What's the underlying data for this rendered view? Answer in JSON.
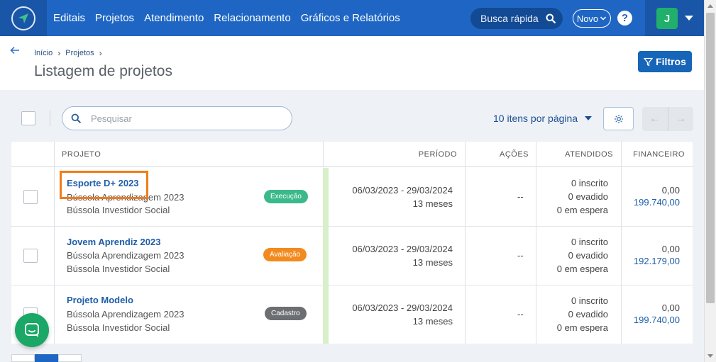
{
  "nav": {
    "items": [
      "Editais",
      "Projetos",
      "Atendimento",
      "Relacionamento",
      "Gráficos e Relatórios"
    ],
    "quick_search": "Busca rápida",
    "novo": "Novo",
    "help": "?",
    "user_initial": "J"
  },
  "breadcrumb": [
    "Início",
    "Projetos"
  ],
  "page_title": "Listagem de projetos",
  "filtros_label": "Filtros",
  "toolbar": {
    "search_placeholder": "Pesquisar",
    "per_page": "10 itens por página"
  },
  "table": {
    "headers": [
      "PROJETO",
      "PERÍODO",
      "AÇÕES",
      "ATENDIDOS",
      "FINANCEIRO"
    ],
    "rows": [
      {
        "name": "Esporte D+ 2023",
        "program": "Bússola Aprendizagem 2023",
        "org": "Bússola Investidor Social",
        "status": "Execução",
        "status_color": "#3bb98a",
        "period": "06/03/2023 - 29/03/2024",
        "duration": "13 meses",
        "acoes": "--",
        "inscrito": "0 inscrito",
        "evadido": "0 evadido",
        "espera": "0 em espera",
        "fin_a": "0,00",
        "fin_b": "199.740,00"
      },
      {
        "name": "Jovem Aprendiz 2023",
        "program": "Bússola Aprendizagem 2023",
        "org": "Bússola Investidor Social",
        "status": "Avaliação",
        "status_color": "#f28a1e",
        "period": "06/03/2023 - 29/03/2024",
        "duration": "13 meses",
        "acoes": "--",
        "inscrito": "0 inscrito",
        "evadido": "0 evadido",
        "espera": "0 em espera",
        "fin_a": "0,00",
        "fin_b": "192.179,00"
      },
      {
        "name": "Projeto Modelo",
        "program": "Bússola Aprendizagem 2023",
        "org": "Bússola Investidor Social",
        "status": "Cadastro",
        "status_color": "#6b6e72",
        "period": "06/03/2023 - 29/03/2024",
        "duration": "13 meses",
        "acoes": "--",
        "inscrito": "0 inscrito",
        "evadido": "0 evadido",
        "espera": "0 em espera",
        "fin_a": "0,00",
        "fin_b": "199.740,00"
      }
    ]
  },
  "colors": {
    "nav_bg": "#1f66c4",
    "accent": "#1665b8",
    "highlight": "#f07c1b",
    "chat": "#1ba765"
  }
}
